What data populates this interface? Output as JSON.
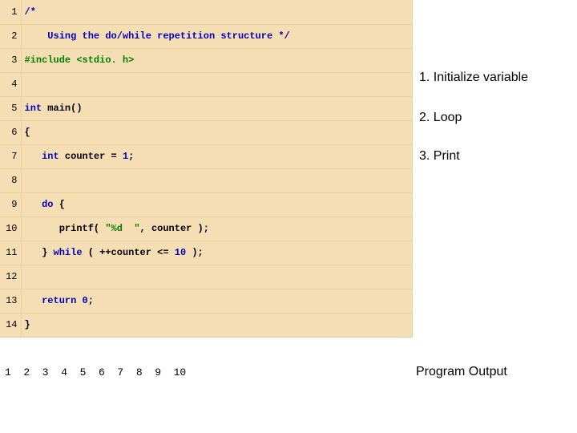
{
  "code": {
    "lines": [
      {
        "n": "1"
      },
      {
        "n": "2",
        "comment": "    Using the do/while repetition structure */"
      },
      {
        "n": "3",
        "inc_kw": "#include ",
        "inc_hdr": "<stdio. h>"
      },
      {
        "n": "4"
      },
      {
        "n": "5",
        "sig_type": "int",
        "sig_rest": " main()"
      },
      {
        "n": "6",
        "plain": "{"
      },
      {
        "n": "7",
        "indent": "   ",
        "kw": "int",
        "after": " counter = ",
        "lit": "1",
        "tail": ";"
      },
      {
        "n": "8"
      },
      {
        "n": "9",
        "indent": "   ",
        "kw": "do",
        "after": " {"
      },
      {
        "n": "10",
        "indent": "      ",
        "call": "printf( ",
        "str": "\"%d  \"",
        "callrest": ", counter );"
      },
      {
        "n": "11",
        "indent": "   ",
        "plain": "} ",
        "kw": "while",
        "after": " ( ++counter <= ",
        "lit": "10",
        "tail": " );"
      },
      {
        "n": "12"
      },
      {
        "n": "13",
        "indent": "   ",
        "kw": "return",
        "after": " ",
        "lit": "0",
        "tail": ";"
      },
      {
        "n": "14",
        "plain": "}"
      }
    ],
    "line1_open": "/*"
  },
  "annotations": {
    "a1": "1. Initialize variable",
    "a2": "2. Loop",
    "a3": "3. Print"
  },
  "output": {
    "text": "1  2  3  4  5  6  7  8  9  10",
    "label": "Program Output"
  }
}
